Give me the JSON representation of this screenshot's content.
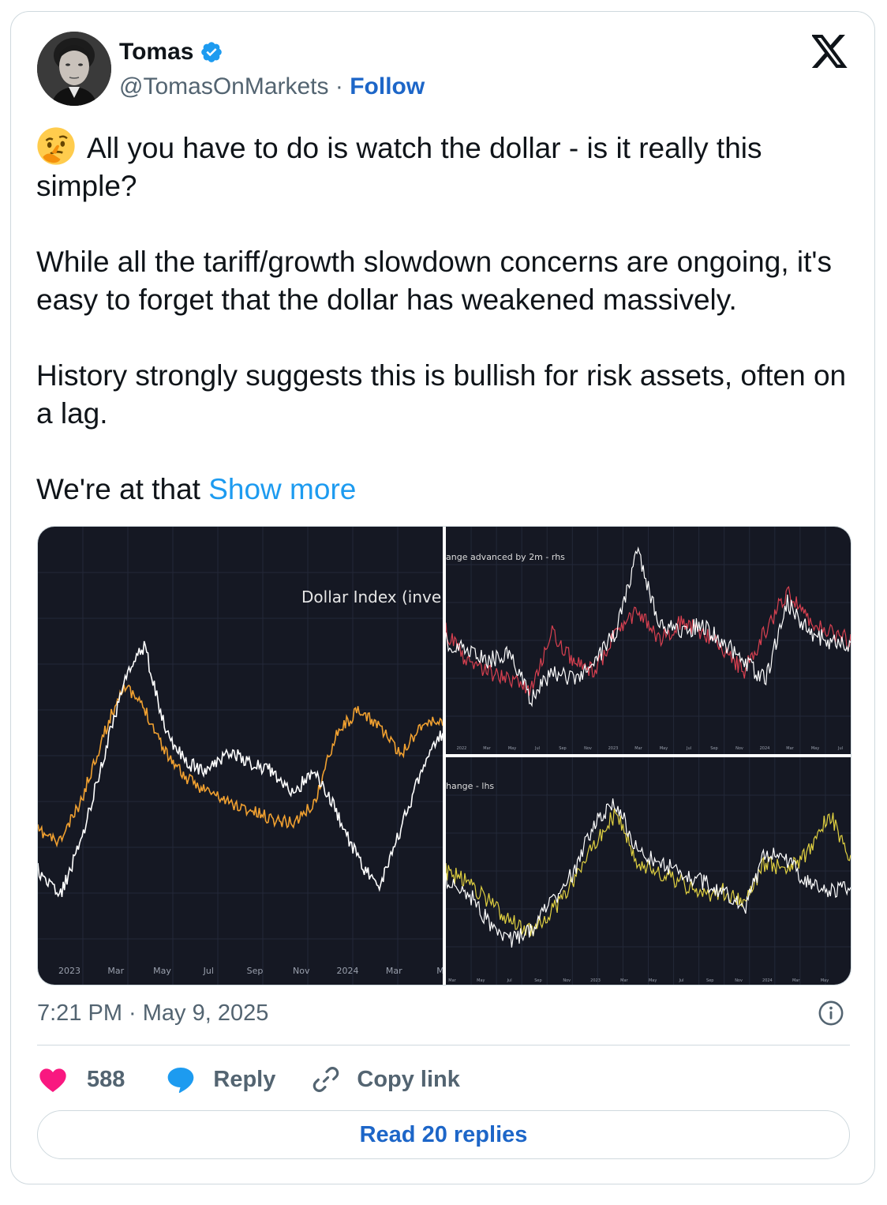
{
  "author": {
    "name": "Tomas",
    "handle": "@TomasOnMarkets",
    "separator": "·",
    "follow_label": "Follow"
  },
  "tweet": {
    "emoji": "thinking-face",
    "line1": "All you have to do is watch the dollar - is it really this simple?",
    "para2": "While all the tariff/growth slowdown concerns are ongoing, it's easy to forget that the dollar has weakened massively.",
    "para3": "History strongly suggests this is bullish for risk assets, often on a lag.",
    "para4_start": "We're at that",
    "show_more": "Show more"
  },
  "media": {
    "left": {
      "title": "Dollar Index (inve",
      "x_ticks": [
        "2023",
        "Mar",
        "May",
        "Jul",
        "Sep",
        "Nov",
        "2024",
        "Mar",
        "M"
      ],
      "series_colors": [
        "#f0a030",
        "#ffffff"
      ]
    },
    "top_right": {
      "title": "ange advanced by 2m - rhs",
      "x_ticks": [
        "2022",
        "Mar",
        "May",
        "Jul",
        "Sep",
        "Nov",
        "2023",
        "Mar",
        "May",
        "Jul",
        "Sep",
        "Nov",
        "2024",
        "Mar",
        "May",
        "Jul"
      ],
      "series_colors": [
        "#d94050",
        "#ffffff"
      ]
    },
    "bottom_right": {
      "title": "hange - lhs",
      "x_ticks": [
        "Mar",
        "May",
        "Jul",
        "Sep",
        "Nov",
        "2023",
        "Mar",
        "May",
        "Jul",
        "Sep",
        "Nov",
        "2024",
        "Mar",
        "May"
      ],
      "series_colors": [
        "#e0d040",
        "#ffffff"
      ]
    }
  },
  "timestamp": "7:21 PM · May 9, 2025",
  "actions": {
    "likes": "588",
    "reply": "Reply",
    "copy_link": "Copy link"
  },
  "read_replies": "Read 20 replies",
  "colors": {
    "accent": "#1d9bf0",
    "follow": "#1d66c8",
    "heart": "#f91880",
    "chart_bg": "#151823"
  }
}
